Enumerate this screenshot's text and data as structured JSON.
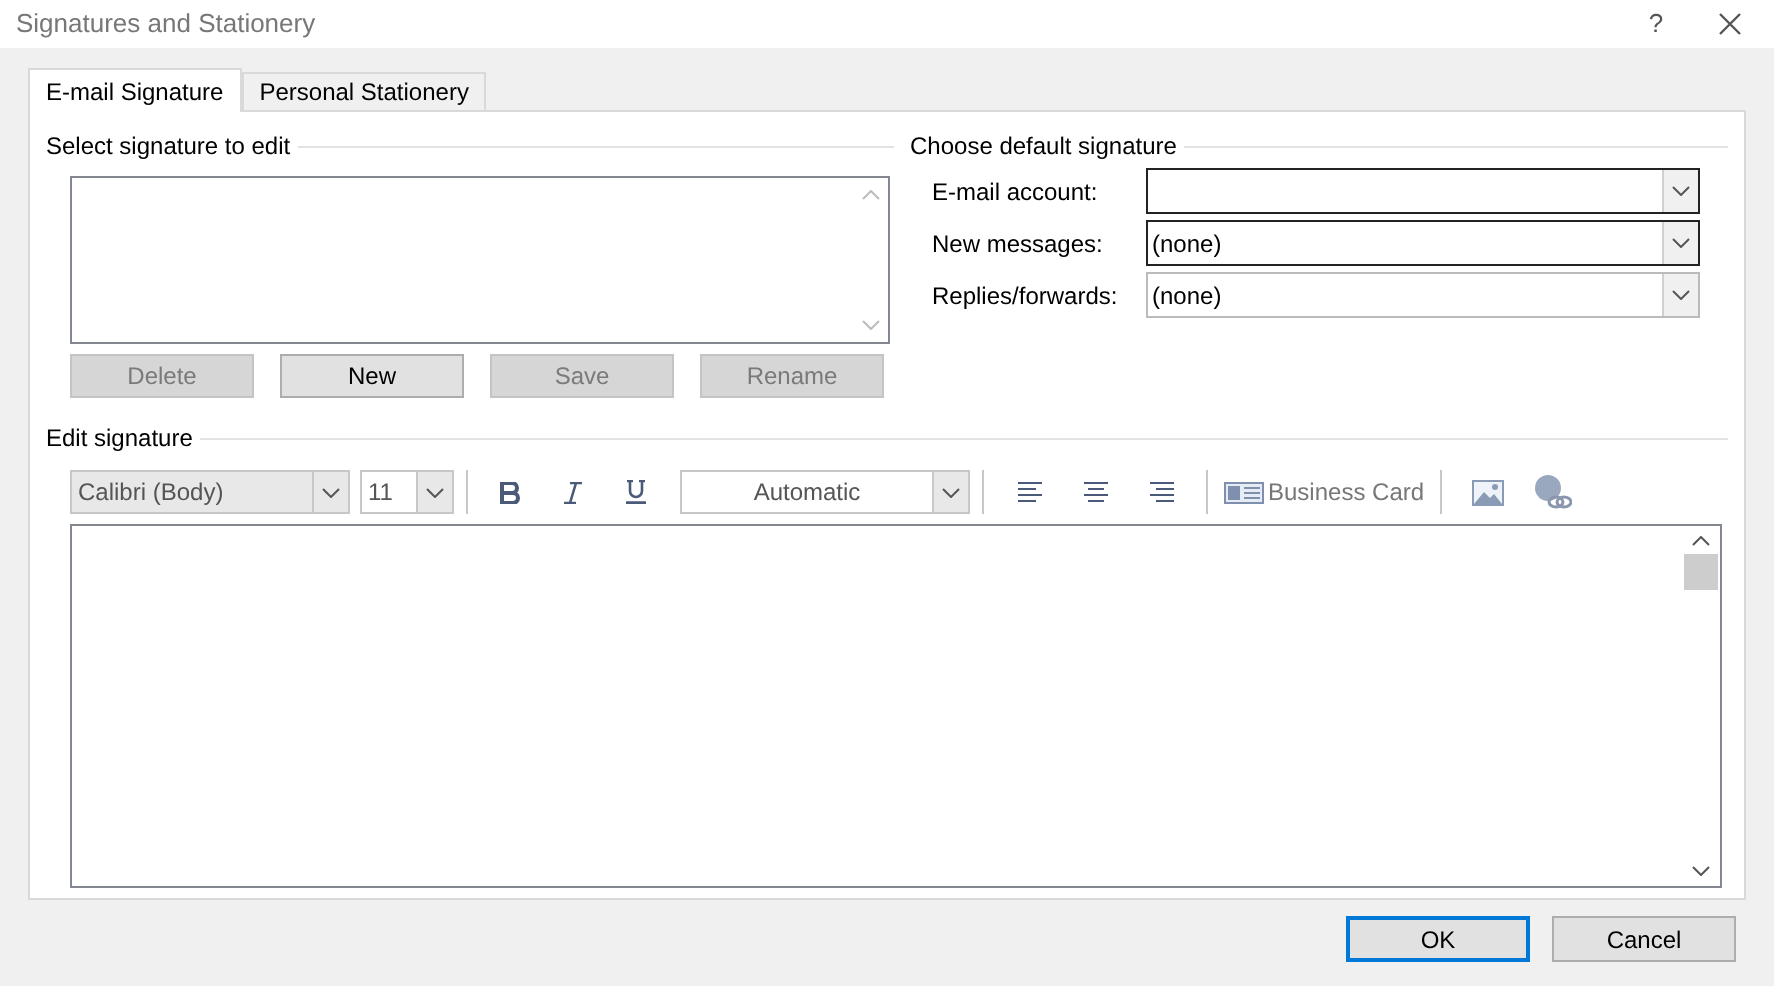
{
  "window": {
    "title": "Signatures and Stationery",
    "help": "?"
  },
  "tabs": [
    {
      "label": "E-mail Signature",
      "selected": true
    },
    {
      "label": "Personal Stationery",
      "selected": false
    }
  ],
  "select_signature": {
    "label": "Select signature to edit",
    "buttons": [
      {
        "label": "Delete",
        "disabled": true
      },
      {
        "label": "New",
        "disabled": false
      },
      {
        "label": "Save",
        "disabled": true
      },
      {
        "label": "Rename",
        "disabled": true
      }
    ]
  },
  "default_signature": {
    "label": "Choose default signature",
    "fields": [
      {
        "label": "E-mail account:",
        "focused": true
      },
      {
        "label": "New messages:",
        "value": "(none)",
        "focused": true
      },
      {
        "label": "Replies/forwards:",
        "value": "(none)",
        "focused": false
      }
    ]
  },
  "edit_signature": {
    "label": "Edit signature",
    "font": "Calibri (Body)",
    "size": "11",
    "font_color": "Automatic",
    "business_card": "Business Card"
  },
  "buttons": [
    {
      "label": "OK",
      "default": true
    },
    {
      "label": "Cancel",
      "default": false
    }
  ]
}
